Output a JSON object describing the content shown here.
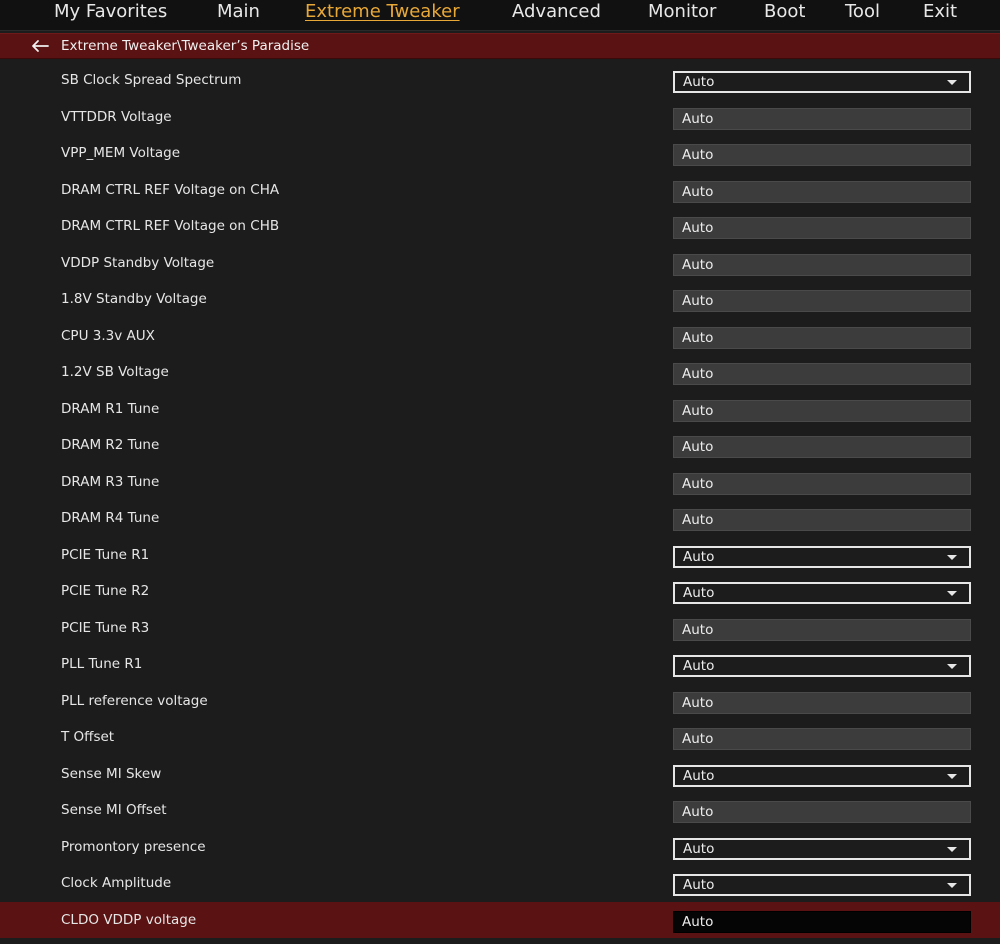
{
  "menu": {
    "tabs": [
      {
        "label": "My Favorites"
      },
      {
        "label": "Main"
      },
      {
        "label": "Extreme Tweaker"
      },
      {
        "label": "Advanced"
      },
      {
        "label": "Monitor"
      },
      {
        "label": "Boot"
      },
      {
        "label": "Tool"
      },
      {
        "label": "Exit"
      }
    ],
    "active_tab": "Extreme Tweaker"
  },
  "breadcrumb": {
    "back_icon": "arrow-left-icon",
    "path": "Extreme Tweaker\\Tweaker’s Paradise"
  },
  "colors": {
    "accent": "#e8a838",
    "header_bar": "#5a1212",
    "background": "#1c1c1c",
    "field": "#3c3c3c"
  },
  "settings": [
    {
      "label": "SB Clock Spread Spectrum",
      "value": "Auto",
      "control": "dropdown"
    },
    {
      "label": "VTTDDR Voltage",
      "value": "Auto",
      "control": "field"
    },
    {
      "label": "VPP_MEM Voltage",
      "value": "Auto",
      "control": "field"
    },
    {
      "label": "DRAM CTRL REF Voltage on CHA",
      "value": "Auto",
      "control": "field"
    },
    {
      "label": "DRAM CTRL REF Voltage on CHB",
      "value": "Auto",
      "control": "field"
    },
    {
      "label": "VDDP Standby Voltage",
      "value": "Auto",
      "control": "field"
    },
    {
      "label": "1.8V Standby Voltage",
      "value": "Auto",
      "control": "field"
    },
    {
      "label": "CPU 3.3v AUX",
      "value": "Auto",
      "control": "field"
    },
    {
      "label": "1.2V SB Voltage",
      "value": "Auto",
      "control": "field"
    },
    {
      "label": "DRAM R1 Tune",
      "value": "Auto",
      "control": "field"
    },
    {
      "label": "DRAM R2 Tune",
      "value": "Auto",
      "control": "field"
    },
    {
      "label": "DRAM R3 Tune",
      "value": "Auto",
      "control": "field"
    },
    {
      "label": "DRAM R4 Tune",
      "value": "Auto",
      "control": "field"
    },
    {
      "label": "PCIE Tune R1",
      "value": "Auto",
      "control": "dropdown"
    },
    {
      "label": "PCIE Tune R2",
      "value": "Auto",
      "control": "dropdown"
    },
    {
      "label": "PCIE Tune R3",
      "value": "Auto",
      "control": "field"
    },
    {
      "label": "PLL Tune R1",
      "value": "Auto",
      "control": "dropdown"
    },
    {
      "label": "PLL reference voltage",
      "value": "Auto",
      "control": "field"
    },
    {
      "label": "T Offset",
      "value": "Auto",
      "control": "field"
    },
    {
      "label": "Sense MI Skew",
      "value": "Auto",
      "control": "dropdown"
    },
    {
      "label": "Sense MI Offset",
      "value": "Auto",
      "control": "field"
    },
    {
      "label": "Promontory presence",
      "value": "Auto",
      "control": "dropdown"
    },
    {
      "label": "Clock Amplitude",
      "value": "Auto",
      "control": "dropdown"
    },
    {
      "label": "CLDO VDDP voltage",
      "value": "Auto",
      "control": "field",
      "selected": true
    }
  ]
}
